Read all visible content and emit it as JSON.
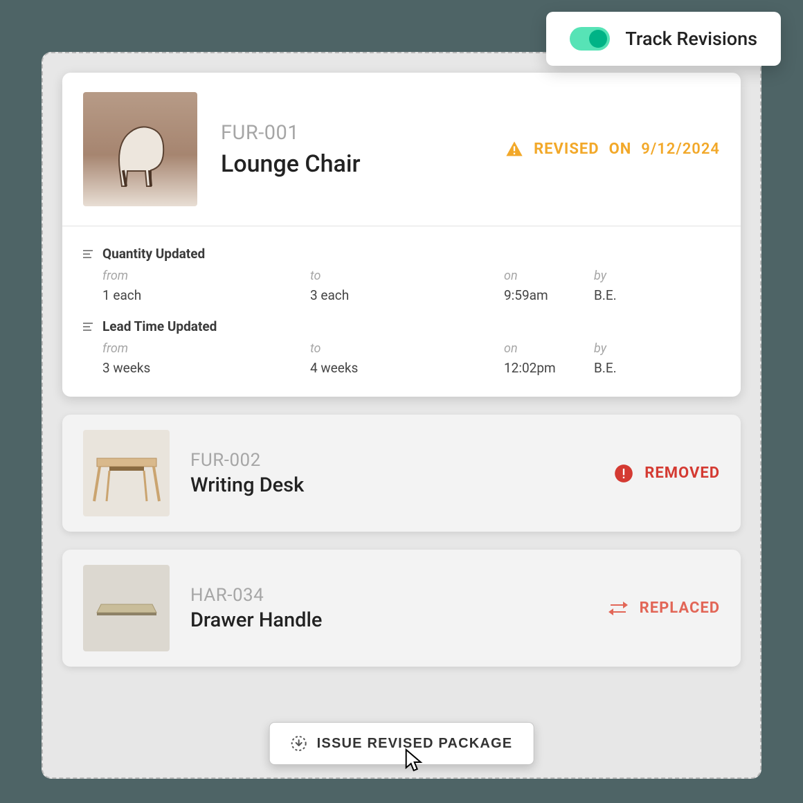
{
  "toolbar": {
    "track_revisions_label": "Track Revisions",
    "track_enabled": true
  },
  "items": [
    {
      "sku": "FUR-001",
      "name": "Lounge Chair",
      "status": "REVISED",
      "revised_on_label": "ON",
      "revised_date": "9/12/2024",
      "changes": [
        {
          "title": "Quantity Updated",
          "from_label": "from",
          "from": "1 each",
          "to_label": "to",
          "to": "3 each",
          "on_label": "on",
          "on": "9:59am",
          "by_label": "by",
          "by": "B.E."
        },
        {
          "title": "Lead Time Updated",
          "from_label": "from",
          "from": "3 weeks",
          "to_label": "to",
          "to": "4 weeks",
          "on_label": "on",
          "on": "12:02pm",
          "by_label": "by",
          "by": "B.E."
        }
      ]
    },
    {
      "sku": "FUR-002",
      "name": "Writing Desk",
      "status": "REMOVED"
    },
    {
      "sku": "HAR-034",
      "name": "Drawer Handle",
      "status": "REPLACED"
    }
  ],
  "action_button": "ISSUE REVISED PACKAGE",
  "colors": {
    "warning": "#f2a829",
    "removed": "#d43a32",
    "replaced": "#e26657",
    "toggle": "#00b386"
  }
}
